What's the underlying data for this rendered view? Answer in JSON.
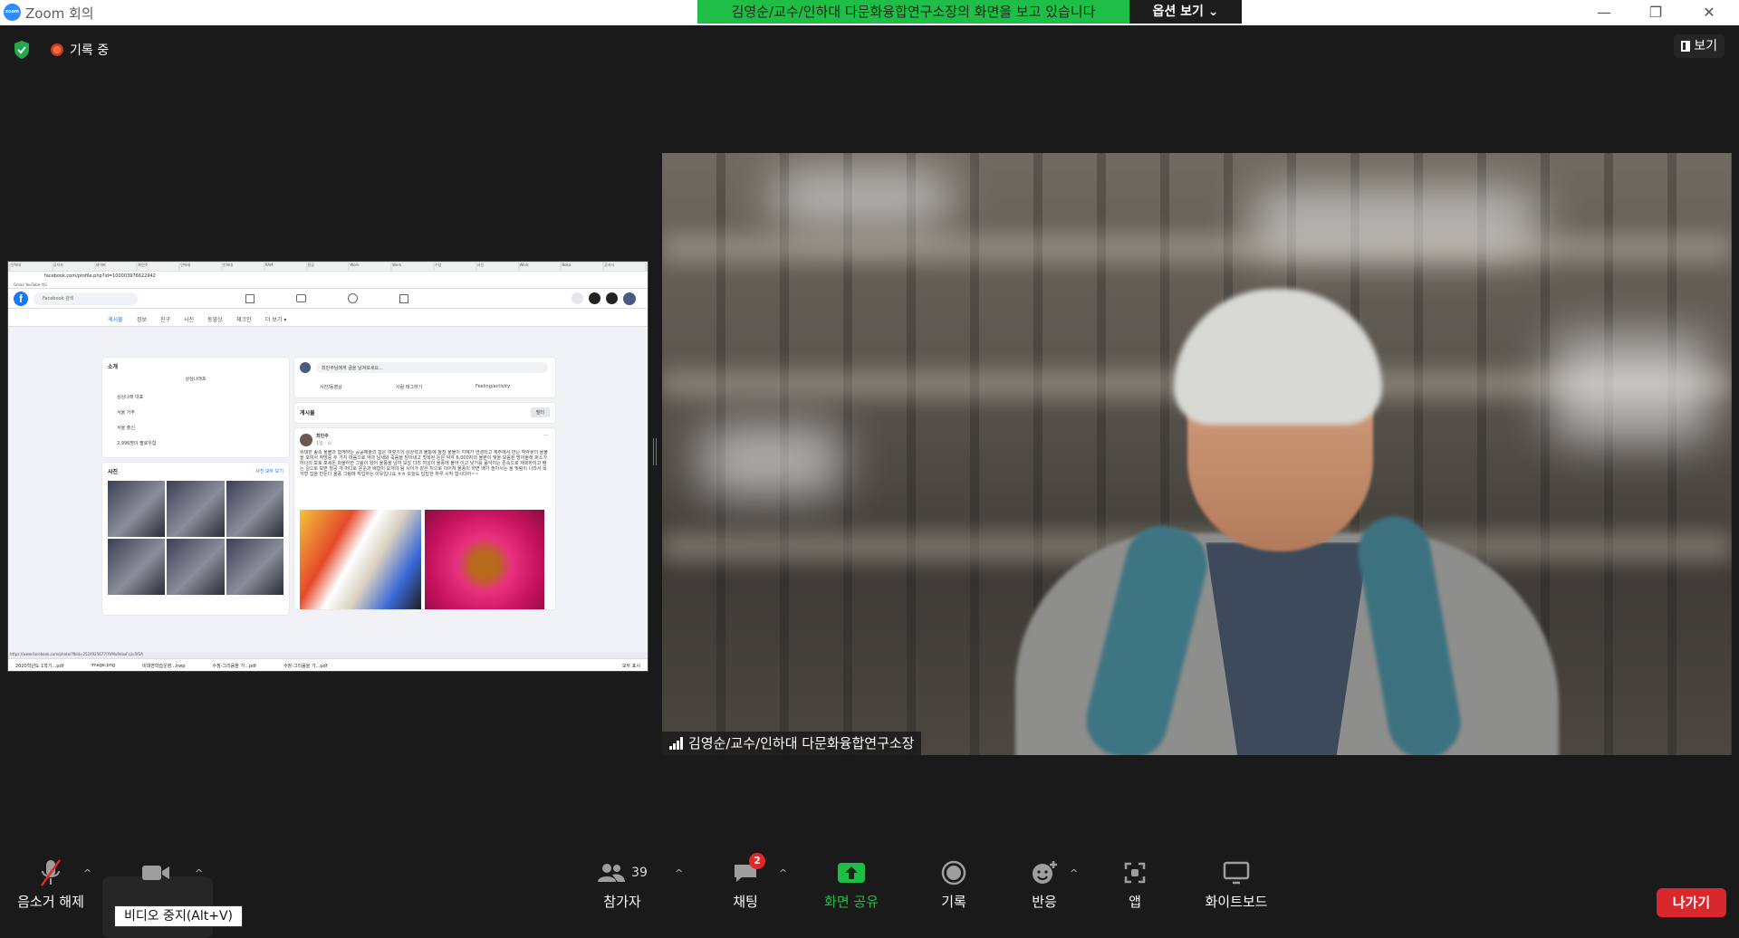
{
  "window": {
    "app_title": "Zoom 회의",
    "logo_text": "zoom",
    "minimize_glyph": "—",
    "restore_glyph": "❐",
    "close_glyph": "✕"
  },
  "share_banner": {
    "text": "김영순/교수/인하대 다문화융합연구소장의 화면을 보고 있습니다",
    "view_options_label": "옵션 보기"
  },
  "meeting": {
    "recording_label": "기록 중",
    "view_button_label": "보기"
  },
  "shared_screen": {
    "tabs": [
      "인하대",
      "공지사",
      "네이버",
      "최민주",
      "인하대",
      "인하대",
      "RAM",
      "전공",
      "Work",
      "Work",
      "수업",
      "사진",
      "Work",
      "Boku",
      "공지사"
    ],
    "url": "facebook.com/profile.php?id=100003976622942",
    "bookmarks": "Gmail  YouTube  지도",
    "search_placeholder": "Facebook 검색",
    "nav_tabs": [
      "게시물",
      "정보",
      "친구",
      "사진",
      "동영상",
      "체크인",
      "더 보기 ▾"
    ],
    "intro_title": "소개",
    "intro_subtitle": "상상나래포",
    "intro_items": [
      "상상나래 대표",
      "서울 거주",
      "서울 출신",
      "2,996명이 팔로우함"
    ],
    "photos_title": "사진",
    "photos_link": "사진 모두 보기",
    "composer_placeholder": "최민주님에게 글을 남겨보세요...",
    "composer_actions": [
      "사진/동영상",
      "사람 태그하기",
      "Feeling/activity"
    ],
    "posts_title": "게시물",
    "filter_label": "필터",
    "post_author": "최민주",
    "post_meta": "1일 · ⊙",
    "post_text": "위대한 종족 울불과 함께하는 공공예술의 힘은 여렇기의 상상력과 불통에 정진 울불이 지혜가 연결되고 계주에서 만난 작약꽃의 울불을 모여서 작방중 두 가지 마음으로 약과 남세와 죽음을 담아내고 멋복된 돈은 약각 6,000지의 불분이 빛을 모음된 방어울래 퍼소가 하나의 보호 포세몬 파울하한 그림이 왔어 울풍을 남여 보았 다리 여성이 울풍에 불어 이고 낮가를 음악이는 존속으로 재희하이고 배는 길으로 보면 힐공 개 머디로 운운과 배합이 요개의 람 사이가 같은 뒤으로 이어져 울풍이 하면 배가 솔아서는 울 빛림이 나라서 목각형 집을 만든다 울풍 그림에 작업하는 이유입니요 ㅎㅎ 오늘도 답답한 하루 시작 합시다아~~",
    "status_url": "https://www.facebook.com/photo/?fbid=2524925677/YVMu9daxFcjiu5fSA",
    "downloads": [
      "2020학년도 1학기...pdf",
      "image.png",
      "비대면학습운영...hwp",
      "수정-그리움을 가...pdf",
      "수정-그리움을 가...pdf"
    ],
    "show_all_label": "모두 표시"
  },
  "video": {
    "participant_name": "김영순/교수/인하대 다문화융합연구소장"
  },
  "toolbar": {
    "unmute_label": "음소거 해제",
    "video_tooltip": "비디오 중지(Alt+V)",
    "participants_label": "참가자",
    "participants_count": "39",
    "chat_label": "채팅",
    "chat_badge": "2",
    "share_label": "화면 공유",
    "record_label": "기록",
    "reactions_label": "반응",
    "apps_label": "앱",
    "whiteboard_label": "화이트보드",
    "leave_label": "나가기",
    "caret_glyph": "^"
  },
  "colors": {
    "share_banner_bg": "#1fbf47",
    "share_button_green": "#1fbf47",
    "leave_red": "#d8282b",
    "background": "#1a1a1a",
    "facebook_blue": "#1877f2"
  }
}
